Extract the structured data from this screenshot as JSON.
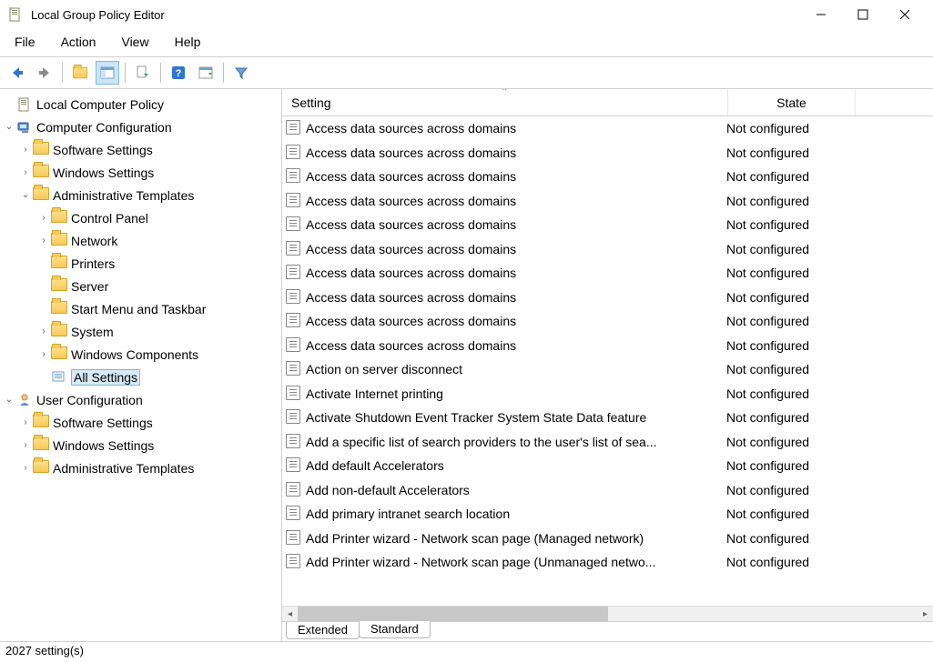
{
  "window": {
    "title": "Local Group Policy Editor"
  },
  "menu": {
    "file": "File",
    "action": "Action",
    "view": "View",
    "help": "Help"
  },
  "tree": {
    "root": "Local Computer Policy",
    "computer_config": "Computer Configuration",
    "cc_software": "Software Settings",
    "cc_windows": "Windows Settings",
    "cc_admin": "Administrative Templates",
    "cc_control_panel": "Control Panel",
    "cc_network": "Network",
    "cc_printers": "Printers",
    "cc_server": "Server",
    "cc_startmenu": "Start Menu and Taskbar",
    "cc_system": "System",
    "cc_wincomp": "Windows Components",
    "cc_allsettings": "All Settings",
    "user_config": "User Configuration",
    "uc_software": "Software Settings",
    "uc_windows": "Windows Settings",
    "uc_admin": "Administrative Templates"
  },
  "columns": {
    "setting": "Setting",
    "state": "State"
  },
  "rows": [
    {
      "setting": "Access data sources across domains",
      "state": "Not configured"
    },
    {
      "setting": "Access data sources across domains",
      "state": "Not configured"
    },
    {
      "setting": "Access data sources across domains",
      "state": "Not configured"
    },
    {
      "setting": "Access data sources across domains",
      "state": "Not configured"
    },
    {
      "setting": "Access data sources across domains",
      "state": "Not configured"
    },
    {
      "setting": "Access data sources across domains",
      "state": "Not configured"
    },
    {
      "setting": "Access data sources across domains",
      "state": "Not configured"
    },
    {
      "setting": "Access data sources across domains",
      "state": "Not configured"
    },
    {
      "setting": "Access data sources across domains",
      "state": "Not configured"
    },
    {
      "setting": "Access data sources across domains",
      "state": "Not configured"
    },
    {
      "setting": "Action on server disconnect",
      "state": "Not configured"
    },
    {
      "setting": "Activate Internet printing",
      "state": "Not configured"
    },
    {
      "setting": "Activate Shutdown Event Tracker System State Data feature",
      "state": "Not configured"
    },
    {
      "setting": "Add a specific list of search providers to the user's list of sea...",
      "state": "Not configured"
    },
    {
      "setting": "Add default Accelerators",
      "state": "Not configured"
    },
    {
      "setting": "Add non-default Accelerators",
      "state": "Not configured"
    },
    {
      "setting": "Add primary intranet search location",
      "state": "Not configured"
    },
    {
      "setting": "Add Printer wizard - Network scan page (Managed network)",
      "state": "Not configured"
    },
    {
      "setting": "Add Printer wizard - Network scan page (Unmanaged netwo...",
      "state": "Not configured"
    }
  ],
  "tabs": {
    "extended": "Extended",
    "standard": "Standard"
  },
  "status": "2027 setting(s)"
}
